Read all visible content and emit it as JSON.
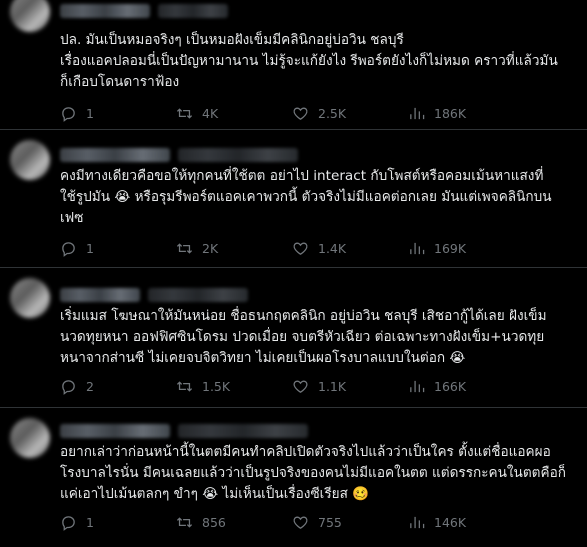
{
  "posts": [
    {
      "text": "ปล. มันเป็นหมอจริงๆ เป็นหมอฝังเข็มมีคลินิกอยู่บ่อวิน ชลบุรี\nเรื่องแอคปลอมนี่เป็นปัญหามานาน ไม่รู้จะแก้ยังไง รีพอร์ตยังไงก็ไม่หมด คราวที่แล้วมัน\nก็เกือบโดนดาราฟ้อง",
      "replies": "1",
      "reposts": "4K",
      "likes": "2.5K",
      "views": "186K"
    },
    {
      "text": "คงมีทางเดียวคือขอให้ทุกคนที่ใช้ตต อย่าไป interact กับโพสต์หรือคอมเม้นหาแสงที่\nใช้รูปมัน 😭 หรือรุมรีพอร์ตแอคเคาพวกนี้ ตัวจริงไม่มีแอคต่อกเลย มันแต่เพจคลินิกบน\nเฟซ",
      "replies": "1",
      "reposts": "2K",
      "likes": "1.4K",
      "views": "169K"
    },
    {
      "text": "เริ่มแมส โฆษณาให้มันหน่อย ชื่อธนกฤตคลินิก อยู่บ่อวิน ชลบุรี เสิชอากู้ได้เลย ฝังเข็ม\nนวดทุยหนา ออฟฟิศซินโดรม ปวดเมื่อย จบตรีหัวเฉียว ต่อเฉพาะทางฝังเข็ม+นวดทุย\nหนาจากส่านซี ไม่เคยจบจิตวิทยา ไม่เคยเป็นผอโรงบาลแบบในต่อก 😭",
      "replies": "2",
      "reposts": "1.5K",
      "likes": "1.1K",
      "views": "166K"
    },
    {
      "text": "อยากเล่าว่าก่อนหน้านี้ในตตมีคนทำคลิปเปิดตัวจริงไปแล้วว่าเป็นใคร ตั้งแต่ชื่อแอคผอ\nโรงบาลไรนั่น มีคนเฉลยแล้วว่าเป็นรูปจริงของคนไม่มีแอคในตต แต่ดรรกะคนในตตคือก็\nแค่เอาไปเม้นตลกๆ ขำๆ 😭 ไม่เห็นเป็นเรื่องซีเรียส 🥴",
      "replies": "1",
      "reposts": "856",
      "likes": "755",
      "views": "146K"
    }
  ],
  "colors": {
    "background": "#000000",
    "text": "#e7e9ea",
    "muted": "#71767b",
    "divider": "#2f3336"
  }
}
